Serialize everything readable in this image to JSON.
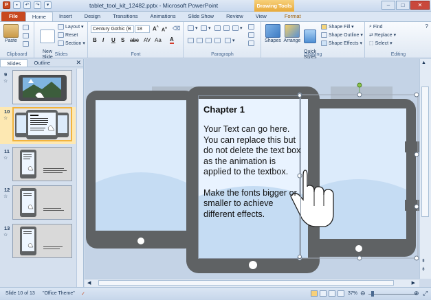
{
  "window": {
    "title": "tablet_tool_kit_12482.pptx - Microsoft PowerPoint",
    "contextual_tab": "Drawing Tools"
  },
  "ribbon_tabs": [
    "File",
    "Home",
    "Insert",
    "Design",
    "Transitions",
    "Animations",
    "Slide Show",
    "Review",
    "View",
    "Format"
  ],
  "ribbon": {
    "clipboard": {
      "label": "Clipboard",
      "paste": "Paste"
    },
    "slides": {
      "label": "Slides",
      "new_slide": "New\nSlide",
      "layout": "Layout",
      "reset": "Reset",
      "section": "Section"
    },
    "font": {
      "label": "Font",
      "font_name": "Century Gothic (B",
      "font_size": "18"
    },
    "paragraph": {
      "label": "Paragraph"
    },
    "drawing": {
      "label": "Drawing",
      "shapes": "Shapes",
      "arrange": "Arrange",
      "quick_styles": "Quick\nStyles",
      "shape_fill": "Shape Fill",
      "shape_outline": "Shape Outline",
      "shape_effects": "Shape Effects"
    },
    "editing": {
      "label": "Editing",
      "find": "Find",
      "replace": "Replace",
      "select": "Select"
    }
  },
  "panel": {
    "tabs": [
      "Slides",
      "Outline"
    ],
    "thumbnails": [
      {
        "number": "9",
        "selected": false
      },
      {
        "number": "10",
        "selected": true
      },
      {
        "number": "11",
        "selected": false
      },
      {
        "number": "12",
        "selected": false
      },
      {
        "number": "13",
        "selected": false
      }
    ]
  },
  "slide": {
    "title": "Chapter 1",
    "paragraph1": "Your Text can go here. You can replace this but do not delete the text box as the animation is applied to the textbox.",
    "paragraph2": "Make the fonts bigger or smaller to achieve different effects."
  },
  "status": {
    "slide_info": "Slide 10 of 13",
    "theme": "\"Office Theme\"",
    "zoom": "37%"
  },
  "colors": {
    "file_tab": "#c8481f",
    "selection": "#f2b33d",
    "tablet_frame": "#5f6264",
    "screen": "#dcebfb"
  }
}
